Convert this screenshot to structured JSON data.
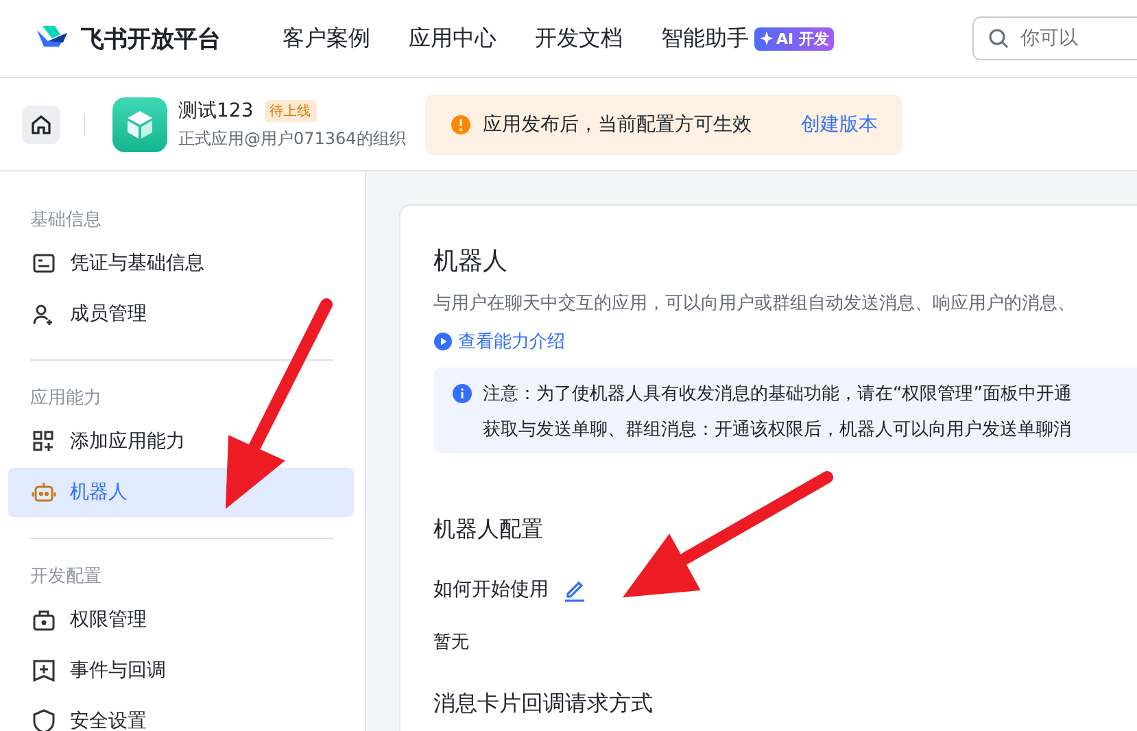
{
  "header": {
    "logo": "飞书开放平台",
    "nav": [
      {
        "label": "客户案例"
      },
      {
        "label": "应用中心"
      },
      {
        "label": "开发文档"
      },
      {
        "label": "智能助手",
        "badge": "AI 开发"
      }
    ],
    "search": {
      "placeholder": "你可以"
    }
  },
  "app_bar": {
    "name": "测试123",
    "status": "待上线",
    "subtitle": "正式应用@用户071364的组织",
    "banner": {
      "message": "应用发布后，当前配置方可生效",
      "action": "创建版本"
    }
  },
  "sidebar": {
    "groups": [
      {
        "title": "基础信息",
        "items": [
          {
            "label": "凭证与基础信息",
            "selected": false
          },
          {
            "label": "成员管理",
            "selected": false
          }
        ]
      },
      {
        "title": "应用能力",
        "items": [
          {
            "label": "添加应用能力",
            "selected": false
          },
          {
            "label": "机器人",
            "selected": true
          }
        ]
      },
      {
        "title": "开发配置",
        "items": [
          {
            "label": "权限管理",
            "selected": false
          },
          {
            "label": "事件与回调",
            "selected": false
          },
          {
            "label": "安全设置",
            "selected": false
          }
        ]
      }
    ]
  },
  "content": {
    "title": "机器人",
    "description": "与用户在聊天中交互的应用，可以向用户或群组自动发送消息、响应用户的消息、",
    "link": "查看能力介绍",
    "notice": [
      "注意：为了使机器人具有收发消息的基础功能，请在“权限管理”面板中开通",
      "获取与发送单聊、群组消息：开通该权限后，机器人可以向用户发送单聊消"
    ],
    "config": {
      "title": "机器人配置",
      "fields": [
        {
          "label": "如何开始使用",
          "value": "暂无"
        }
      ],
      "next_label": "消息卡片回调请求方式"
    }
  }
}
